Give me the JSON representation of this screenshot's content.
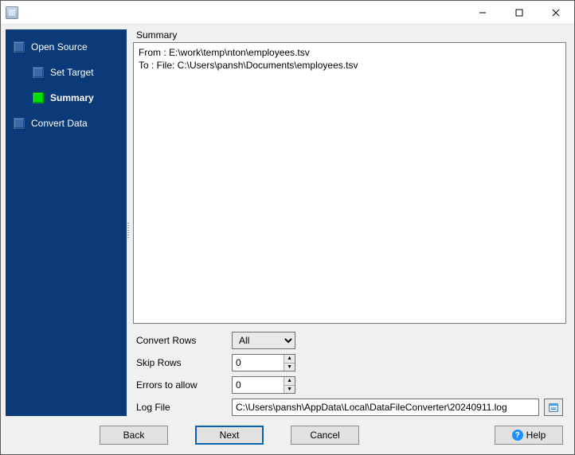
{
  "window": {
    "title": ""
  },
  "sidebar": {
    "items": [
      {
        "label": "Open Source"
      },
      {
        "label": "Set Target"
      },
      {
        "label": "Summary"
      },
      {
        "label": "Convert Data"
      }
    ]
  },
  "summary": {
    "heading": "Summary",
    "lines": "From : E:\\work\\temp\\nton\\employees.tsv\nTo : File: C:\\Users\\pansh\\Documents\\employees.tsv"
  },
  "form": {
    "convert_rows": {
      "label": "Convert Rows",
      "value": "All"
    },
    "skip_rows": {
      "label": "Skip Rows",
      "value": "0"
    },
    "errors": {
      "label": "Errors to allow",
      "value": "0"
    },
    "log_file": {
      "label": "Log File",
      "value": "C:\\Users\\pansh\\AppData\\Local\\DataFileConverter\\20240911.log"
    }
  },
  "buttons": {
    "back": "Back",
    "next": "Next",
    "cancel": "Cancel",
    "help": "Help"
  }
}
